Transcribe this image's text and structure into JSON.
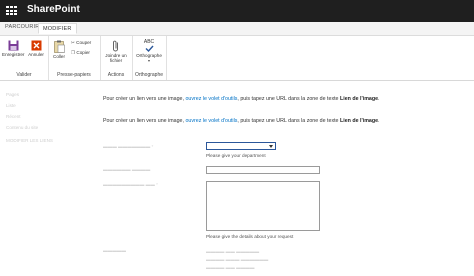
{
  "suite": {
    "app_name": "SharePoint"
  },
  "tabs": [
    {
      "label": "PARCOURIR",
      "active": false
    },
    {
      "label": "MODIFIER",
      "active": true
    }
  ],
  "ribbon": {
    "groups": [
      {
        "label": "Valider",
        "buttons": [
          "Enregistrer",
          "Annuler"
        ]
      },
      {
        "label": "Presse-papiers",
        "buttons": [
          "Coller",
          "Couper",
          "Copier"
        ]
      },
      {
        "label": "Actions",
        "buttons": [
          "Joindre un fichier"
        ]
      },
      {
        "label": "Orthographe",
        "buttons": [
          "Orthographe"
        ]
      }
    ],
    "spelling_icon_text": "ABC"
  },
  "nav": {
    "items": [
      "Pages",
      "Liste",
      "Récent",
      "Contenu du site",
      "MODIFIER LES LIENS"
    ]
  },
  "content": {
    "para1": {
      "before": "Pour créer un lien vers une image, ",
      "link": "ouvrez le volet d'outils",
      "after": ", puis tapez une URL dans la zone de texte ",
      "bold": "Lien de l'image",
      "end": "."
    },
    "para2": {
      "before": "Pour créer un lien vers une image, ",
      "link": "ouvrez le volet d'outils",
      "after": ", puis tapez une URL dans la zone de texte ",
      "bold": "Lien de l'image",
      "end": "."
    },
    "department_hint": "Please give your department",
    "details_hint": "Please give the details about your request"
  },
  "colors": {
    "suite_bar": "#1f1f1f",
    "link": "#0072c6",
    "focus_border": "#2b579a",
    "save_icon": "#7a3c97",
    "cancel_icon": "#d83b01"
  }
}
